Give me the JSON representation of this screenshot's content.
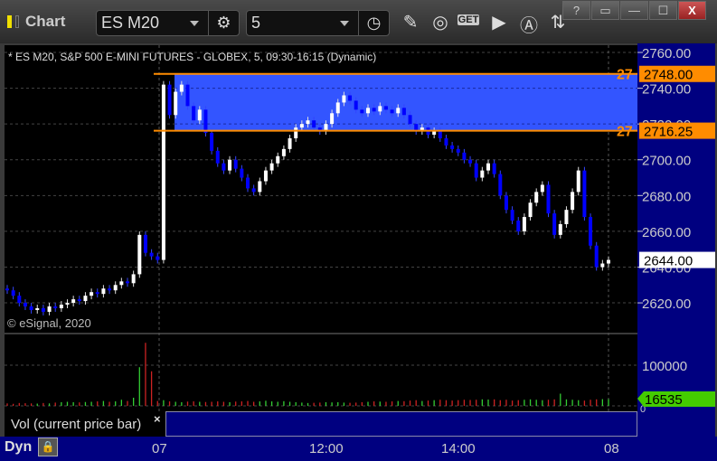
{
  "window": {
    "title": "Chart",
    "help": "?",
    "buttons": [
      "?",
      "▭",
      "—",
      "☐",
      "X"
    ]
  },
  "toolbar": {
    "symbol": "ES M20",
    "interval": "5",
    "icons": [
      "settings-icon",
      "clock-icon",
      "pencil-icon",
      "study-icon",
      "get-icon",
      "play-icon",
      "alert-icon",
      "link-icon"
    ]
  },
  "chart_header": "* ES M20, S&P 500 E-MINI FUTURES - GLOBEX, 5, 09:30-16:15 (Dynamic)",
  "copyright": "© eSignal, 2020",
  "colors": {
    "up": "#ffffff",
    "down": "#0000ff",
    "zone": "#3355ff",
    "level": "#ff8c00",
    "axis_bg": "#000080",
    "vol_up": "#33cc33",
    "vol_down": "#cc2222",
    "last_vol": "#44cc00"
  },
  "chart_data": {
    "type": "candlestick",
    "ylim": [
      2610,
      2765
    ],
    "y_ticks": [
      "2760.00",
      "2740.00",
      "2720.00",
      "2700.00",
      "2680.00",
      "2660.00",
      "2640.00",
      "2620.00"
    ],
    "x_ticks": [
      "07",
      "12:00",
      "14:00",
      "08"
    ],
    "close": [
      2627,
      2624,
      2620,
      2618,
      2616,
      2617,
      2615,
      2618,
      2617,
      2619,
      2620,
      2622,
      2621,
      2624,
      2626,
      2625,
      2628,
      2627,
      2630,
      2632,
      2631,
      2636,
      2658,
      2648,
      2646,
      2644,
      2742,
      2725,
      2738,
      2742,
      2730,
      2722,
      2728,
      2715,
      2705,
      2698,
      2694,
      2700,
      2695,
      2690,
      2684,
      2682,
      2688,
      2694,
      2698,
      2702,
      2706,
      2712,
      2718,
      2720,
      2722,
      2718,
      2716,
      2720,
      2726,
      2732,
      2736,
      2733,
      2728,
      2726,
      2729,
      2727,
      2730,
      2728,
      2726,
      2729,
      2725,
      2720,
      2716,
      2718,
      2714,
      2716,
      2712,
      2708,
      2706,
      2704,
      2700,
      2698,
      2690,
      2694,
      2698,
      2692,
      2680,
      2672,
      2666,
      2660,
      2668,
      2676,
      2682,
      2686,
      2670,
      2658,
      2664,
      2672,
      2682,
      2694,
      2668,
      2652,
      2640,
      2642,
      2644
    ],
    "levels": [
      {
        "price": 2748.0,
        "label": "2748.00",
        "tag": "27"
      },
      {
        "price": 2716.25,
        "label": "2716.25",
        "tag": "27"
      }
    ],
    "last_price": "2644.00",
    "volume": {
      "y_ticks": [
        "100000",
        "0"
      ],
      "max": 170000,
      "last": "16535",
      "label": "Vol (current price bar)",
      "values": [
        6000,
        5000,
        7000,
        6500,
        6000,
        5500,
        7000,
        6000,
        8000,
        9000,
        10000,
        9000,
        8500,
        9500,
        10000,
        11000,
        12000,
        10000,
        11000,
        15000,
        12000,
        20000,
        95000,
        155000,
        85000,
        12000,
        14000,
        11000,
        10000,
        9000,
        10500,
        11000,
        10000,
        9500,
        10000,
        11000,
        10000,
        9000,
        10500,
        11000,
        12000,
        10000,
        11000,
        12500,
        11000,
        10000,
        11500,
        10000,
        9000,
        8000,
        7000,
        7500,
        8000,
        9000,
        8500,
        9000,
        8000,
        7500,
        8000,
        9000,
        10000,
        11000,
        10500,
        10000,
        11000,
        12000,
        11500,
        13000,
        14000,
        12000,
        13000,
        14000,
        15000,
        14000,
        13000,
        14000,
        15000,
        14500,
        15000,
        16000,
        15500,
        16000,
        14000,
        15000,
        13000,
        14000,
        15000,
        16000,
        15000,
        14000,
        15000,
        16000,
        30000,
        16000,
        15000,
        14000,
        13000,
        15000,
        16000,
        16535,
        16535
      ]
    }
  }
}
